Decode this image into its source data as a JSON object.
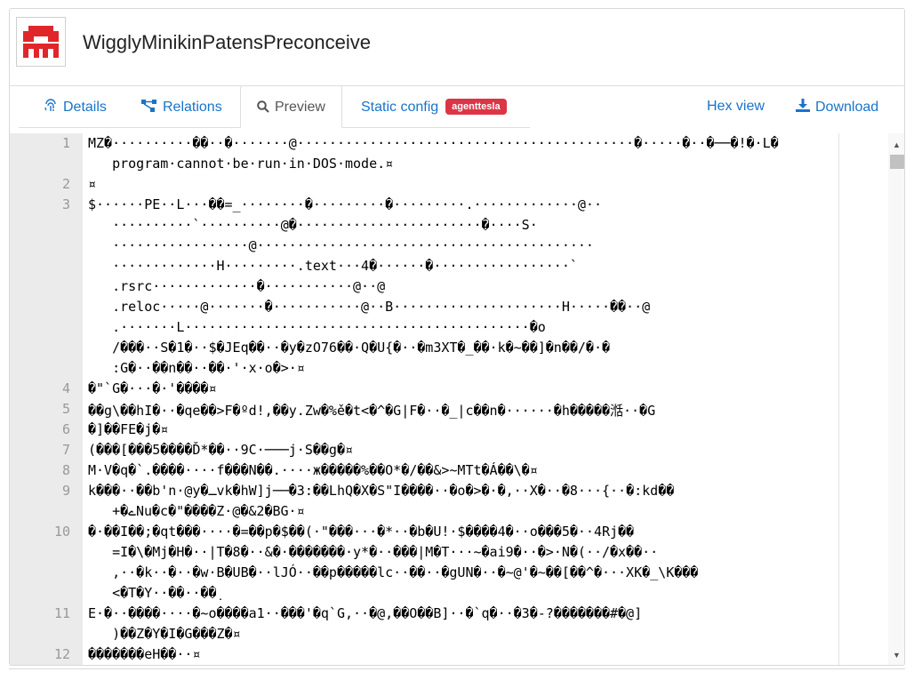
{
  "header": {
    "title": "WigglyMinikinPatensPreconceive",
    "logo_icon": "sample-logo-icon",
    "logo_color": "#e0262b"
  },
  "tabs": {
    "details": "Details",
    "relations": "Relations",
    "preview": "Preview",
    "static_config": "Static config",
    "static_config_badge": "agenttesla",
    "hex_view": "Hex view",
    "download": "Download"
  },
  "code": {
    "lines": [
      {
        "num": "1",
        "rows": [
          "MZ�··········��··�·······@··········································�·····�··�──�!�·L�",
          "   program·cannot·be·run·in·DOS·mode.¤"
        ]
      },
      {
        "num": "2",
        "rows": [
          "¤"
        ]
      },
      {
        "num": "3",
        "rows": [
          "$······PE··L···��=_········�·········�·········.·············@··",
          "   ··········`··········@�·······················�····S·",
          "   ·················@··········································",
          "   ·············H·········.text···4�······�·················`",
          "   .rsrc·············�···········@··@",
          "   .reloc·····@·······�···········@··B·····················H·····��··@",
          "   .·······L···········································�o",
          "   /���··S�1�··$�JEq��··�y�zO76��·Q�U{�··�m3XT�_��·k�~��]�n��/�·�",
          "   :G�··��n��··��·'·x·o�>·¤"
        ]
      },
      {
        "num": "4",
        "rows": [
          "�\"`G�···�·'����¤"
        ]
      },
      {
        "num": "5",
        "rows": [
          "��g\\��hI�··�qe��>F�ºd!,��y.Zw�%ě�t<�^�G|F�··�_|c��n�······�h�����湉··�G"
        ]
      },
      {
        "num": "6",
        "rows": [
          "�]��FE�j�¤"
        ]
      },
      {
        "num": "7",
        "rows": [
          "(���[���5����Ď*��··9C·───j·S��g�¤"
        ]
      },
      {
        "num": "8",
        "rows": [
          "M·V�q�`.����····f���N��.····ж�����%��O*�/��&>~MTt�Á��\\�¤"
        ]
      },
      {
        "num": "9",
        "rows": [
          "k���··��b'n·@y�ـvk�hW]j──�3:��LhQ�X�S\"I����··�o�>�·�,··X�··�8···{··�:kd��",
          "   +�ےNu�c�\"����Z·@�&2�BG·¤"
        ]
      },
      {
        "num": "10",
        "rows": [
          "�·��I��;�qt���····�=��p�$��(·\"���···�*··�b�U!·$����4�··o���5�··4Rj��",
          "   =I�\\�Mj�H�··|T�8�··&�·�������·y*�··���|M�T···~�ai9�··�>·N�(··/�x��··",
          "   ,··�k··�··�w·B�UB�··lJÓ··��p�����lc··��··�gUN�··�~@'�~��[��^�···XK�_\\K���",
          "   <�T�Y··��··��̣"
        ]
      },
      {
        "num": "11",
        "rows": [
          "E·�··����····�~o����a1··���'�q`G,··�@,��O��B]··�`q�··�3�-?�������#�@]",
          "   )��Z�Y�I�G���Z�¤"
        ]
      },
      {
        "num": "12",
        "rows": [
          "�������eH��··¤"
        ]
      }
    ]
  }
}
